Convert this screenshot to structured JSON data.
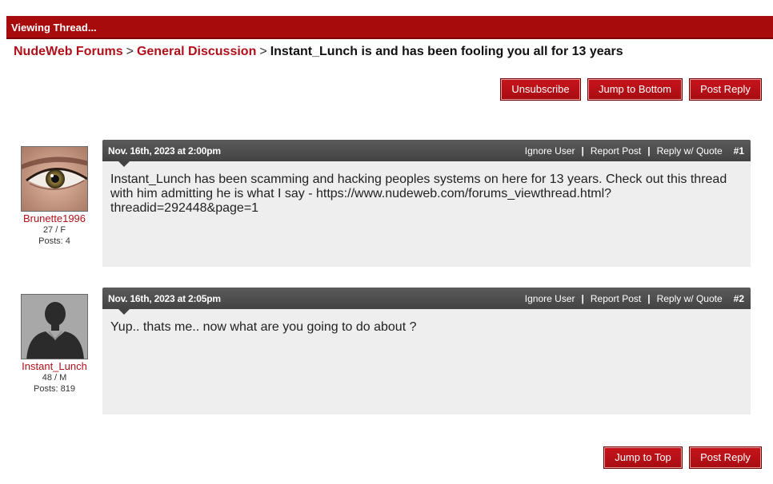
{
  "header": {
    "title": "Viewing Thread..."
  },
  "breadcrumb": {
    "forum": "NudeWeb Forums",
    "separator": ">",
    "category": "General Discussion",
    "thread": "Instant_Lunch is and has been fooling you all for 13 years"
  },
  "top_buttons": {
    "unsubscribe": "Unsubscribe",
    "jump_bottom": "Jump to Bottom",
    "post_reply": "Post Reply"
  },
  "bottom_buttons": {
    "jump_top": "Jump to Top",
    "post_reply": "Post Reply"
  },
  "post_actions": {
    "ignore": "Ignore User",
    "report": "Report Post",
    "quote": "Reply w/ Quote",
    "divider": "|"
  },
  "posts": [
    {
      "author": "Brunette1996",
      "age_sex": "27 / F",
      "posts": "Posts: 4",
      "date": "Nov. 16th, 2023 at 2:00pm",
      "number": "#1",
      "content": "Instant_Lunch has been scamming and hacking peoples systems on here for 13 years. Check out this thread with him admitting he is what I say - https://www.nudeweb.com/forums_viewthread.html?threadid=292448&page=1",
      "avatar_icon": "eye-photo"
    },
    {
      "author": "Instant_Lunch",
      "age_sex": "48 / M",
      "posts": "Posts: 819",
      "date": "Nov. 16th, 2023 at 2:05pm",
      "number": "#2",
      "content": "Yup.. thats me.. now what are you going to do about ?",
      "avatar_icon": "default-user-silhouette"
    }
  ],
  "colors": {
    "brand": "#a80b0b",
    "link": "#b0101a",
    "post_header": "#4a4a4a",
    "post_bg": "#eeeeee"
  }
}
